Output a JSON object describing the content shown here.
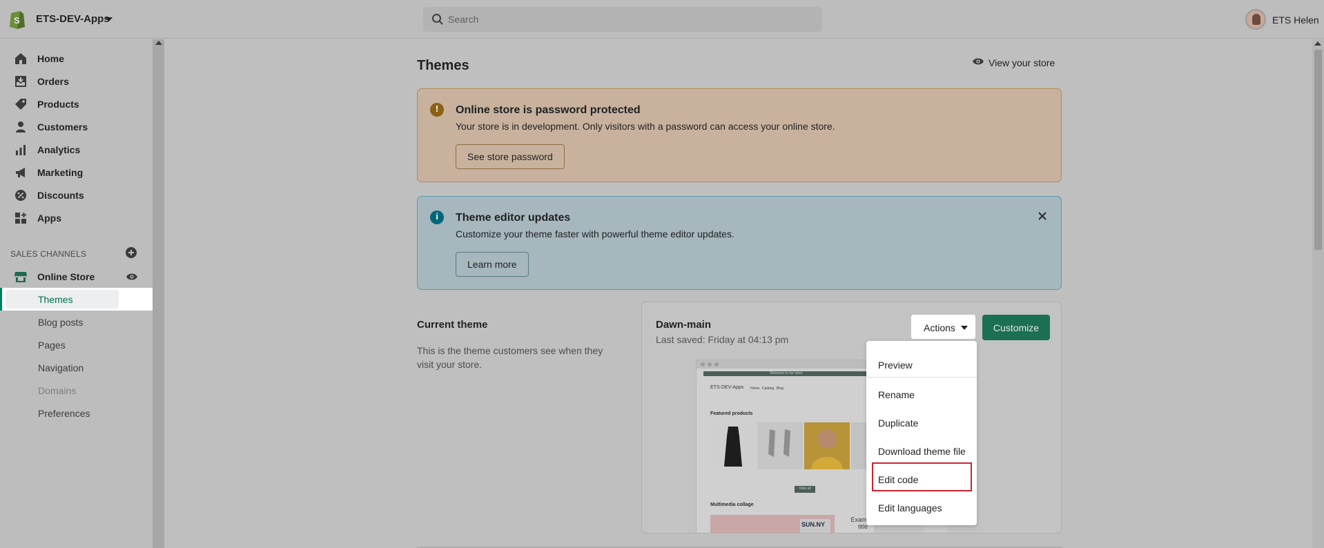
{
  "topbar": {
    "store_name": "ETS-DEV-Apps",
    "search_placeholder": "Search",
    "user_name": "ETS Helen"
  },
  "sidebar": {
    "items": [
      {
        "label": "Home",
        "icon": "home-icon"
      },
      {
        "label": "Orders",
        "icon": "orders-icon"
      },
      {
        "label": "Products",
        "icon": "tag-icon"
      },
      {
        "label": "Customers",
        "icon": "person-icon"
      },
      {
        "label": "Analytics",
        "icon": "bar-chart-icon"
      },
      {
        "label": "Marketing",
        "icon": "megaphone-icon"
      },
      {
        "label": "Discounts",
        "icon": "discount-icon"
      },
      {
        "label": "Apps",
        "icon": "apps-icon"
      }
    ],
    "sales_channels_label": "SALES CHANNELS",
    "online_store_label": "Online Store",
    "sub_items": [
      {
        "label": "Themes",
        "active": true
      },
      {
        "label": "Blog posts"
      },
      {
        "label": "Pages"
      },
      {
        "label": "Navigation"
      },
      {
        "label": "Domains",
        "disabled": true
      },
      {
        "label": "Preferences"
      }
    ]
  },
  "main": {
    "title": "Themes",
    "view_store": "View your store",
    "password_banner": {
      "title": "Online store is password protected",
      "text": "Your store is in development. Only visitors with a password can access your online store.",
      "button": "See store password"
    },
    "editor_banner": {
      "title": "Theme editor updates",
      "text": "Customize your theme faster with powerful theme editor updates.",
      "button": "Learn more"
    },
    "current_theme": {
      "section_title": "Current theme",
      "section_desc": "This is the theme customers see when they visit your store.",
      "theme_name": "Dawn-main",
      "last_saved": "Last saved: Friday at 04:13 pm",
      "actions_label": "Actions",
      "customize_label": "Customize"
    },
    "preview": {
      "announcement": "Welcome to our store",
      "store_name": "ETS-DEV-Apps",
      "nav_home": "Home",
      "nav_catalog": "Catalog",
      "nav_blog": "Blog",
      "featured": "Featured products",
      "view_all": "View all",
      "multimedia": "Multimedia collage",
      "brand": "SUN.NY",
      "example_title": "Example title"
    },
    "actions_menu": [
      "Preview",
      "Rename",
      "Duplicate",
      "Download theme file",
      "Edit code",
      "Edit languages"
    ]
  },
  "colors": {
    "accent": "#008060",
    "customize_button": "#1b6f53",
    "highlight_box": "#d0212f"
  }
}
